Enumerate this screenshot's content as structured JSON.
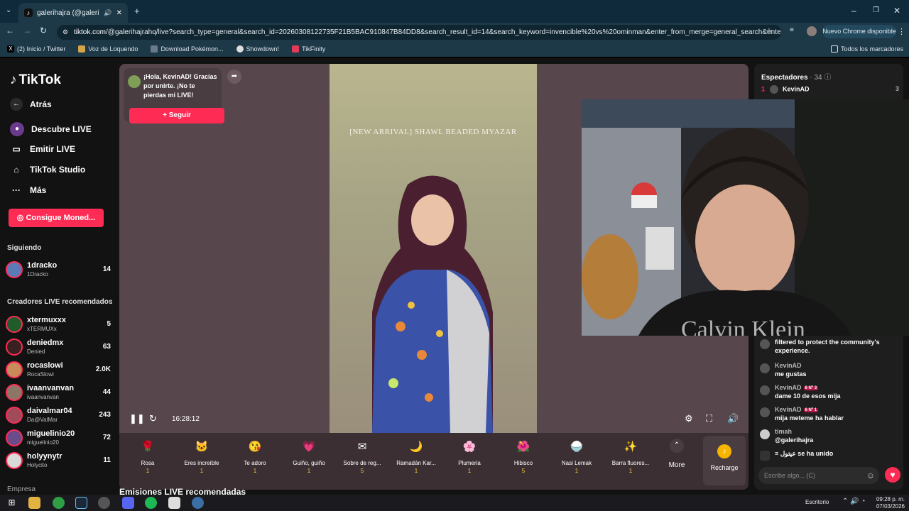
{
  "browser": {
    "tab_title": "galerihajra (@galerihajrahq)",
    "url_host": "tiktok.com",
    "url_path": "/@galerihajrahq/live?search_type=general&search_id=20260308122735F21B5BAC910847B84DD8&search_result_id=14&search_keyword=invencible%20vs%20ominman&enter_from_merge=general_search&enter_method...",
    "chrome_notice": "Nuevo Chrome disponible",
    "bookmarks": [
      "(2) Inicio / Twitter",
      "Voz de Loquendo",
      "Download Pokémon...",
      "Showdown!",
      "TikFinity"
    ],
    "all_bookmarks": "Todos los marcadores"
  },
  "sidebar": {
    "logo": "TikTok",
    "back": "Atrás",
    "nav": [
      "Descubre LIVE",
      "Emitir LIVE",
      "TikTok Studio",
      "Más"
    ],
    "coins_button": "Consigue Moned...",
    "following_title": "Siguiendo",
    "following": [
      {
        "name": "1dracko",
        "sub": "1Dracko",
        "count": "14"
      }
    ],
    "recommended_title": "Creadores LIVE recomendados",
    "creators": [
      {
        "name": "xtermuxxx",
        "sub": "xTERMUXx",
        "count": "5"
      },
      {
        "name": "deniedmx",
        "sub": "Denied",
        "count": "63"
      },
      {
        "name": "rocaslowi",
        "sub": "RocaSlowi",
        "count": "2.0K"
      },
      {
        "name": "ivaanvanvan",
        "sub": "ivaanvanvan",
        "count": "44"
      },
      {
        "name": "daivalmar04",
        "sub": "Da@ValMar",
        "count": "243"
      },
      {
        "name": "miguelinio20",
        "sub": "miguelinio20",
        "count": "72"
      },
      {
        "name": "holyynytr",
        "sub": "Holycito",
        "count": "11"
      }
    ],
    "company": "Empresa"
  },
  "stage": {
    "greeting": "¡Hola, KevinAD! Gracias por unirte. ¡No te pierdas mi LIVE!",
    "follow_button": "+ Seguir",
    "video_title": "[NEW ARRIVAL] SHAWL BEADED MYAZAR",
    "timer": "16:28:12",
    "gifts": [
      {
        "name": "Rosa",
        "price": "1",
        "icon": "🌹"
      },
      {
        "name": "Eres increíble",
        "price": "1",
        "icon": "🐱"
      },
      {
        "name": "Te adoro",
        "price": "1",
        "icon": "😘"
      },
      {
        "name": "Guiño, guiño",
        "price": "1",
        "icon": "💗"
      },
      {
        "name": "Sobre de reg...",
        "price": "5",
        "icon": "✉"
      },
      {
        "name": "Ramadán Kar...",
        "price": "1",
        "icon": "🌙"
      },
      {
        "name": "Plumeria",
        "price": "1",
        "icon": "🌸"
      },
      {
        "name": "Hibisco",
        "price": "5",
        "icon": "🌺"
      },
      {
        "name": "Nasi Lemak",
        "price": "1",
        "icon": "🍚"
      },
      {
        "name": "Barra fluores...",
        "price": "1",
        "icon": "✨"
      }
    ],
    "more": "More",
    "recharge": "Recharge",
    "recommended_streams": "Emisiones LIVE recomendadas"
  },
  "chat": {
    "viewers_label": "Espectadores",
    "viewers_count": "· 34",
    "top_viewer": {
      "rank": "1",
      "name": "KevinAD",
      "count": "3"
    },
    "notice": "filtered to protect the community's experience.",
    "messages": [
      {
        "user": "KevinAD",
        "text": "me gustas",
        "badge": ""
      },
      {
        "user": "KevinAD",
        "text": "dame 10 de esos mija",
        "badge": "6 Nº 3"
      },
      {
        "user": "KevinAD",
        "text": "mija meteme ha hablar",
        "badge": "6 Nº 1"
      },
      {
        "user": "timah",
        "text": "@galerihajra",
        "badge": ""
      }
    ],
    "joined": "≡ عيتول  se ha unido",
    "input_placeholder": "Escribe algo... (C)"
  },
  "webcam": {
    "shirt_text": "Calvin Klein"
  },
  "taskbar": {
    "desktop": "Escritorio",
    "time": "09:28 p. m.",
    "date": "07/03/2026"
  },
  "colors": {
    "accent": "#fe2c55",
    "stage_bg": "#57464b",
    "chrome_bg": "#1d3847"
  }
}
